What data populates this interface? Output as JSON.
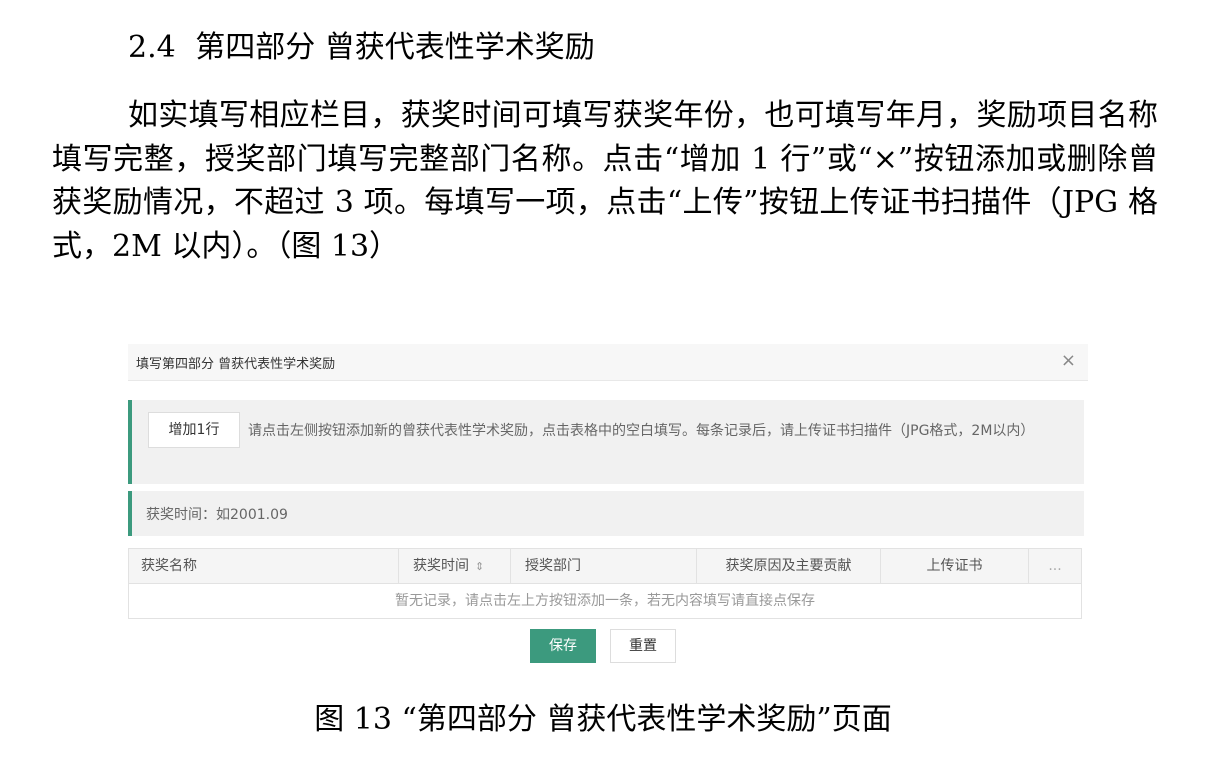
{
  "doc": {
    "section_number": "2.4",
    "section_title": "第四部分  曾获代表性学术奖励",
    "paragraph": "如实填写相应栏目，获奖时间可填写获奖年份，也可填写年月，奖励项目名称填写完整，授奖部门填写完整部门名称。点击“增加 1 行”或“×”按钮添加或删除曾获奖励情况，不超过 3 项。每填写一项，点击“上传”按钮上传证书扫描件（JPG 格式，2M 以内）。（图 13）",
    "caption": "图 13 “第四部分  曾获代表性学术奖励”页面"
  },
  "modal": {
    "title": "填写第四部分 曾获代表性学术奖励",
    "close": "×"
  },
  "tip": {
    "add_button": "增加1行",
    "text": "请点击左侧按钮添加新的曾获代表性学术奖励，点击表格中的空白填写。每条记录后，请上传证书扫描件（JPG格式，2M以内）"
  },
  "time_hint": "获奖时间：如2001.09",
  "table": {
    "columns": [
      "获奖名称",
      "获奖时间",
      "授奖部门",
      "获奖原因及主要贡献",
      "上传证书",
      "..."
    ],
    "sort_icon": "⇕",
    "empty_text": "暂无记录，请点击左上方按钮添加一条，若无内容填写请直接点保存"
  },
  "actions": {
    "save": "保存",
    "reset": "重置"
  }
}
